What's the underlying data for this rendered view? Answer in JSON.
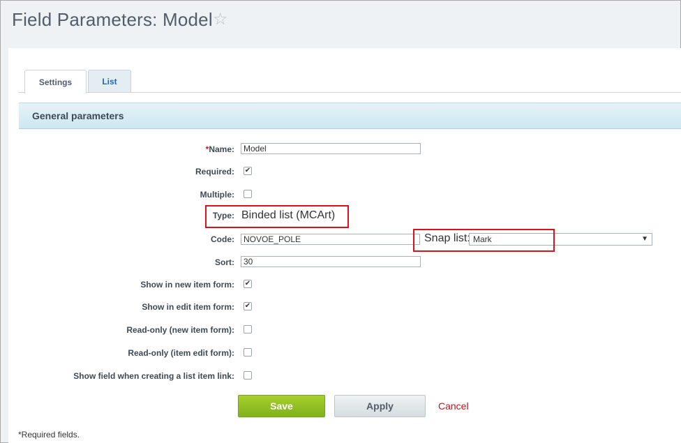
{
  "header": {
    "title": "Field Parameters: Model",
    "favorite_icon": "☆"
  },
  "tabs": [
    {
      "label": "Settings",
      "active": true
    },
    {
      "label": "List",
      "active": false
    }
  ],
  "section": {
    "title": "General parameters"
  },
  "form": {
    "name": {
      "required_mark": "*",
      "label": "Name:",
      "value": "Model"
    },
    "required": {
      "label": "Required:",
      "checked": true
    },
    "multiple": {
      "label": "Multiple:",
      "checked": false
    },
    "type": {
      "label": "Type:",
      "value": "Binded list (MCArt)"
    },
    "code": {
      "label": "Code:",
      "value": "NOVOE_POLE"
    },
    "snap_list": {
      "label": "Snap list:",
      "value": "Mark",
      "arrow": "▼"
    },
    "sort": {
      "label": "Sort:",
      "value": "30"
    },
    "show_new": {
      "label": "Show in new item form:",
      "checked": true
    },
    "show_edit": {
      "label": "Show in edit item form:",
      "checked": true
    },
    "readonly_new": {
      "label": "Read-only (new item form):",
      "checked": false
    },
    "readonly_edit": {
      "label": "Read-only (item edit form):",
      "checked": false
    },
    "show_link": {
      "label": "Show field when creating a list item link:",
      "checked": false
    }
  },
  "buttons": {
    "save": "Save",
    "apply": "Apply",
    "cancel": "Cancel"
  },
  "footnote": "*Required fields.",
  "colors": {
    "accent_green": "#8bbf1f",
    "cancel_red": "#c0141b",
    "highlight_red": "#e0101a",
    "header_blue": "#cde7f1"
  }
}
